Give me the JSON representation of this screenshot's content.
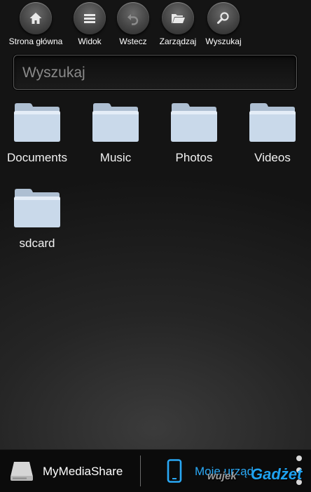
{
  "toolbar": {
    "buttons": [
      {
        "label": "Strona główna",
        "icon": "home-icon"
      },
      {
        "label": "Widok",
        "icon": "list-icon"
      },
      {
        "label": "Wstecz",
        "icon": "back-icon"
      },
      {
        "label": "Zarządzaj",
        "icon": "folder-open-icon"
      },
      {
        "label": "Wyszukaj",
        "icon": "search-icon"
      }
    ]
  },
  "search": {
    "placeholder": "Wyszukaj",
    "value": ""
  },
  "folders": [
    {
      "label": "Documents",
      "icon": "folder-icon"
    },
    {
      "label": "Music",
      "icon": "folder-icon"
    },
    {
      "label": "Photos",
      "icon": "folder-icon"
    },
    {
      "label": "Videos",
      "icon": "folder-icon"
    },
    {
      "label": "sdcard",
      "icon": "folder-icon"
    }
  ],
  "bottom_bar": {
    "tabs": [
      {
        "label": "MyMediaShare",
        "icon": "drive-icon",
        "active": false
      },
      {
        "label": "Moje urząd",
        "icon": "phone-icon",
        "active": true
      }
    ],
    "menu_icon": "overflow-menu-icon"
  },
  "watermark": {
    "part1": "wujek",
    "part2": "Gadżet"
  },
  "colors": {
    "accent": "#29a8f5",
    "folder": "#c9d9ea",
    "background": "#1e1e1e"
  }
}
